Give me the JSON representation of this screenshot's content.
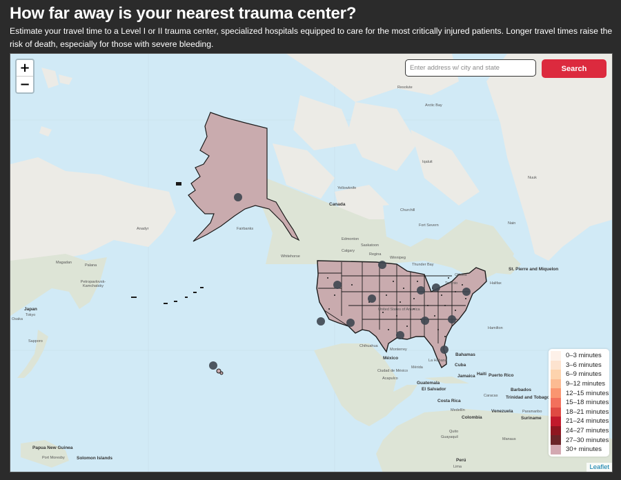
{
  "header": {
    "title": "How far away is your nearest trauma center?",
    "description": "Estimate your travel time to a Level I or II trauma center, specialized hospitals equipped to care for the most critically injured patients. Longer travel times raise the risk of death, especially for those with severe bleeding."
  },
  "map": {
    "zoom_in_label": "+",
    "zoom_out_label": "−",
    "search": {
      "placeholder": "Enter address w/ city and state",
      "value": "",
      "button_label": "Search"
    },
    "attribution": "Leaflet",
    "colors": {
      "water": "#d1eaf6",
      "land": "#ecebe6",
      "forest": "#d4dfcc",
      "us_fill": "#c9abae",
      "us_border": "#1a1a1a",
      "center_marker": "#3e4650",
      "search_button": "#dc2a3e"
    },
    "place_labels": [
      {
        "name": "Canada",
        "bold": true
      },
      {
        "name": "United States of America",
        "bold": false
      },
      {
        "name": "México",
        "bold": true
      },
      {
        "name": "Cuba",
        "bold": true
      },
      {
        "name": "Jamaica",
        "bold": true
      },
      {
        "name": "Haiti",
        "bold": true
      },
      {
        "name": "Puerto Rico",
        "bold": true
      },
      {
        "name": "Bahamas",
        "bold": true
      },
      {
        "name": "Guatemala",
        "bold": true
      },
      {
        "name": "El Salvador",
        "bold": true
      },
      {
        "name": "Costa Rica",
        "bold": true
      },
      {
        "name": "Barbados",
        "bold": true
      },
      {
        "name": "Trinidad and Tobago",
        "bold": true
      },
      {
        "name": "Venezuela",
        "bold": true
      },
      {
        "name": "Colombia",
        "bold": true
      },
      {
        "name": "Suriname",
        "bold": true
      },
      {
        "name": "Perú",
        "bold": true
      },
      {
        "name": "Japan",
        "bold": true
      },
      {
        "name": "Papua New Guinea",
        "bold": true
      },
      {
        "name": "Solomon Islands",
        "bold": true
      },
      {
        "name": "St. Pierre and Miquelon",
        "bold": true
      },
      {
        "name": "Hamilton",
        "bold": false
      },
      {
        "name": "Churchill",
        "bold": false
      },
      {
        "name": "Fort Severn",
        "bold": false
      },
      {
        "name": "Nain",
        "bold": false
      },
      {
        "name": "Edmonton",
        "bold": false
      },
      {
        "name": "Saskatoon",
        "bold": false
      },
      {
        "name": "Calgary",
        "bold": false
      },
      {
        "name": "Regina",
        "bold": false
      },
      {
        "name": "Winnipeg",
        "bold": false
      },
      {
        "name": "Thunder Bay",
        "bold": false
      },
      {
        "name": "Toronto",
        "bold": false
      },
      {
        "name": "Ottawa",
        "bold": false
      },
      {
        "name": "Halifax",
        "bold": false
      },
      {
        "name": "Resolute",
        "bold": false
      },
      {
        "name": "Arctic Bay",
        "bold": false
      },
      {
        "name": "Iqaluit",
        "bold": false
      },
      {
        "name": "Nuuk",
        "bold": false
      },
      {
        "name": "Yellowknife",
        "bold": false
      },
      {
        "name": "Whitehorse",
        "bold": false
      },
      {
        "name": "Fairbanks",
        "bold": false
      },
      {
        "name": "Anadyr",
        "bold": false
      },
      {
        "name": "Magadan",
        "bold": false
      },
      {
        "name": "Palana",
        "bold": false
      },
      {
        "name": "Petropavlovsk-Kamchatsky",
        "bold": false
      },
      {
        "name": "Sapporo",
        "bold": false
      },
      {
        "name": "Tokyo",
        "bold": false
      },
      {
        "name": "Osaka",
        "bold": false
      },
      {
        "name": "Port Moresby",
        "bold": false
      },
      {
        "name": "Chihuahua",
        "bold": false
      },
      {
        "name": "Monterrey",
        "bold": false
      },
      {
        "name": "La Habana",
        "bold": false
      },
      {
        "name": "Mérida",
        "bold": false
      },
      {
        "name": "Ciudad de México",
        "bold": false
      },
      {
        "name": "Acapulco",
        "bold": false
      },
      {
        "name": "Caracas",
        "bold": false
      },
      {
        "name": "Medellín",
        "bold": false
      },
      {
        "name": "Quito",
        "bold": false
      },
      {
        "name": "Guayaquil",
        "bold": false
      },
      {
        "name": "Lima",
        "bold": false
      },
      {
        "name": "Manaus",
        "bold": false
      },
      {
        "name": "Paramaribo",
        "bold": false
      }
    ]
  },
  "legend": {
    "items": [
      {
        "label": "0–3 minutes",
        "color": "#fdf1e9"
      },
      {
        "label": "3–6 minutes",
        "color": "#fde3cf"
      },
      {
        "label": "6–9 minutes",
        "color": "#fdd3ad"
      },
      {
        "label": "9–12 minutes",
        "color": "#fcbb92"
      },
      {
        "label": "12–15 minutes",
        "color": "#fa9570"
      },
      {
        "label": "15–18 minutes",
        "color": "#f2705c"
      },
      {
        "label": "18–21 minutes",
        "color": "#df4a43"
      },
      {
        "label": "21–24 minutes",
        "color": "#c21a2c"
      },
      {
        "label": "24–27 minutes",
        "color": "#8f1620"
      },
      {
        "label": "27–30 minutes",
        "color": "#6b2428"
      },
      {
        "label": "30+ minutes",
        "color": "#d3a8b1"
      }
    ]
  }
}
